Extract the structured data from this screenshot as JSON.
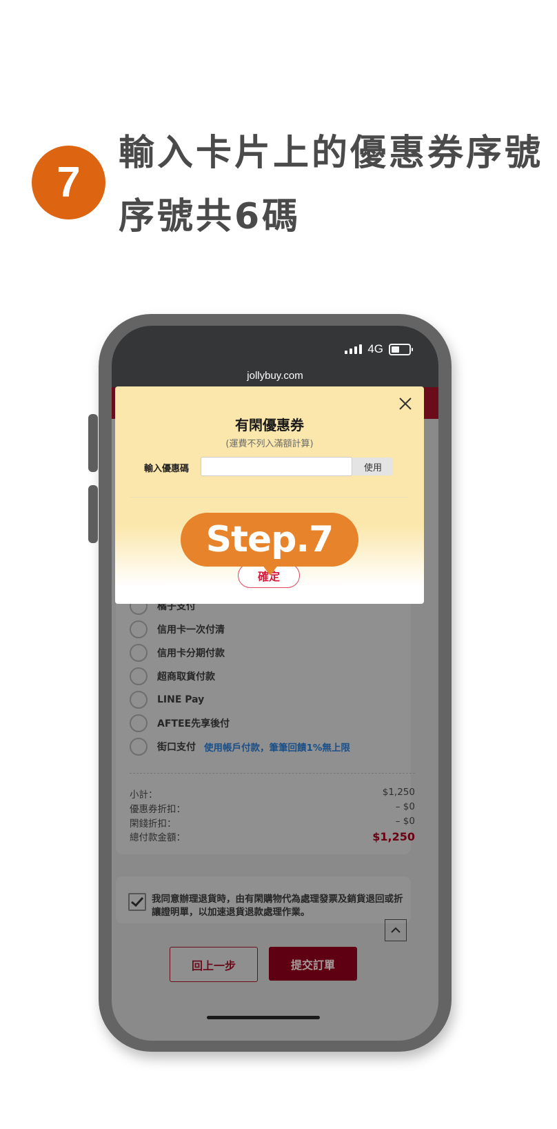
{
  "step": {
    "number": "7",
    "heading_line1": "輸入卡片上的優惠券序號",
    "heading_line2": "序號共6碼",
    "bubble": "Step.7"
  },
  "status_bar": {
    "network": "4G"
  },
  "browser": {
    "url": "jollybuy.com"
  },
  "coupon_modal": {
    "title": "有閑優惠券",
    "subtitle": "(運費不列入滿額計算)",
    "input_label": "輸入優惠碼",
    "input_value": "",
    "use_button": "使用",
    "confirm_button": "確定"
  },
  "payment": {
    "options": [
      {
        "label": "橘子支付",
        "note": ""
      },
      {
        "label": "信用卡一次付清",
        "note": ""
      },
      {
        "label": "信用卡分期付款",
        "note": ""
      },
      {
        "label": "超商取貨付款",
        "note": ""
      },
      {
        "label": "LINE Pay",
        "note": ""
      },
      {
        "label": "AFTEE先享後付",
        "note": ""
      },
      {
        "label": "街口支付",
        "note": "使用帳戶付款，筆筆回饋1%無上限"
      }
    ]
  },
  "summary": {
    "subtotal_label": "小計：",
    "subtotal": "$1,250",
    "coupon_label": "優惠券折扣：",
    "coupon": "– $0",
    "points_label": "閑錢折扣：",
    "points": "– $0",
    "total_label": "總付款金額：",
    "total": "$1,250"
  },
  "agreement": {
    "checked": true,
    "text": "我同意辦理退貨時，由有閑購物代為處理發票及銷貨退回或折讓證明單，以加速退貨退款處理作業。"
  },
  "actions": {
    "back": "回上一步",
    "submit": "提交訂單"
  },
  "colors": {
    "step_circle": "#dd6410",
    "bubble": "#e7832a",
    "brand_red": "#6b0c1b",
    "modal_bg": "#fbe7ab"
  },
  "icons": [
    "signal-icon",
    "battery-icon",
    "close-icon",
    "checkmark-icon",
    "chevron-up-icon"
  ]
}
